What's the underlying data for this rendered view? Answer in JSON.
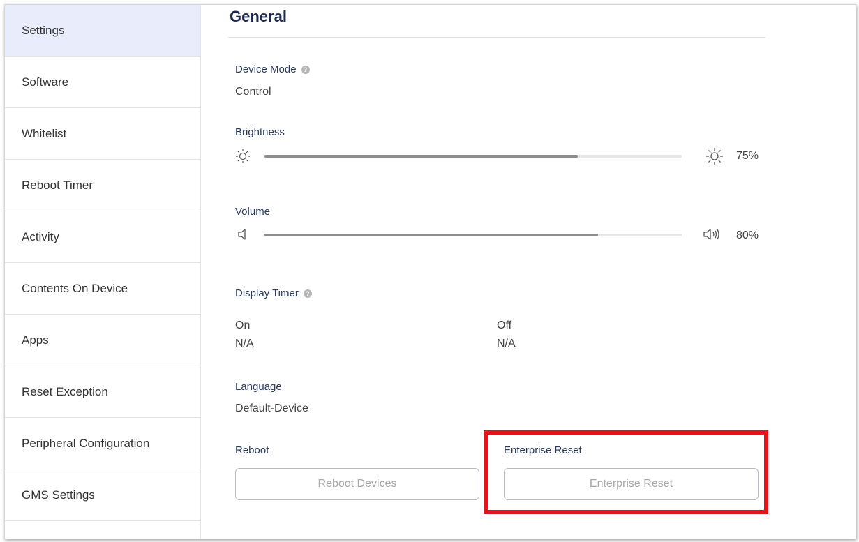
{
  "sidebar": {
    "items": [
      {
        "label": "Settings",
        "active": true
      },
      {
        "label": "Software"
      },
      {
        "label": "Whitelist"
      },
      {
        "label": "Reboot Timer"
      },
      {
        "label": "Activity"
      },
      {
        "label": "Contents On Device"
      },
      {
        "label": "Apps"
      },
      {
        "label": "Reset Exception"
      },
      {
        "label": "Peripheral Configuration"
      },
      {
        "label": "GMS Settings"
      }
    ]
  },
  "main": {
    "title": "General",
    "device_mode": {
      "label": "Device Mode",
      "value": "Control"
    },
    "brightness": {
      "label": "Brightness",
      "value_text": "75%",
      "level": 0.75,
      "icon_low": "sun-low-icon",
      "icon_high": "sun-high-icon"
    },
    "volume": {
      "label": "Volume",
      "value_text": "80%",
      "level": 0.8,
      "icon_low": "speaker-low-icon",
      "icon_high": "speaker-high-icon"
    },
    "display_timer": {
      "label": "Display Timer",
      "on_label": "On",
      "on_value": "N/A",
      "off_label": "Off",
      "off_value": "N/A"
    },
    "language": {
      "label": "Language",
      "value": "Default-Device"
    },
    "reboot": {
      "label": "Reboot",
      "button": "Reboot Devices"
    },
    "enterprise_reset": {
      "label": "Enterprise Reset",
      "button": "Enterprise Reset"
    }
  },
  "colors": {
    "accent_active": "#e9edfb",
    "highlight": "#e0161f",
    "slider_fill": "#8e8e8e"
  }
}
